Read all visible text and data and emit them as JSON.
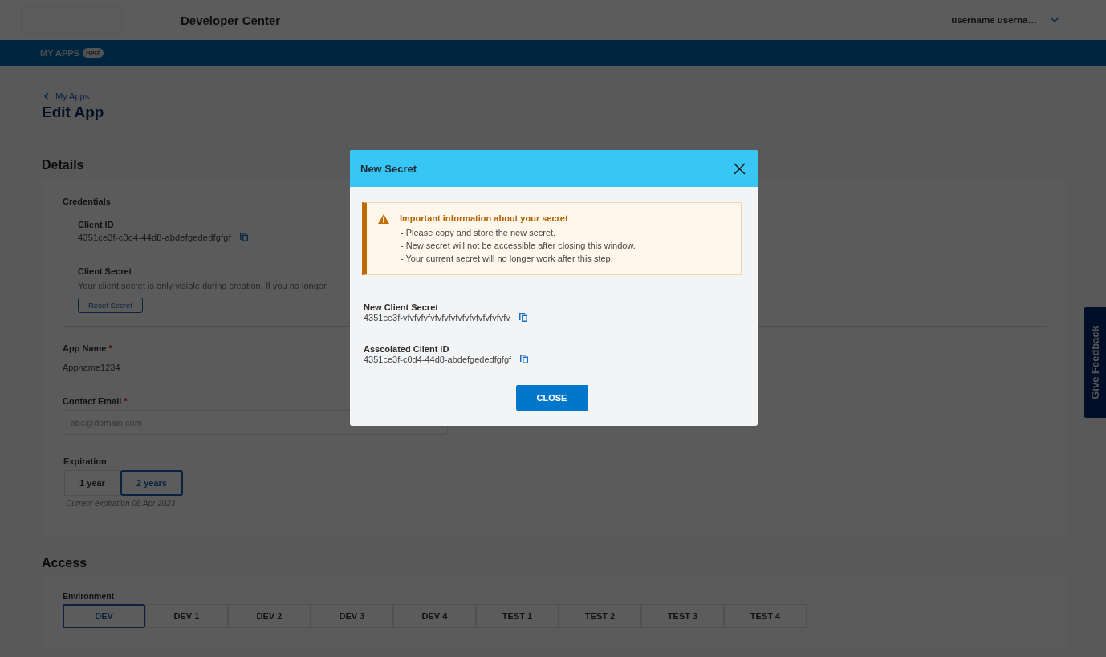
{
  "header": {
    "title": "Developer Center",
    "user": "username userna…"
  },
  "nav": {
    "items": [
      {
        "label": "MY APPS",
        "badge": "Beta"
      }
    ]
  },
  "breadcrumb": "My Apps",
  "page_title": "Edit App",
  "details": {
    "heading": "Details",
    "credentials": {
      "heading": "Credentials",
      "client_id_label": "Client ID",
      "client_id": "4351ce3f-c0d4-44d8-abdefgededfgfgf",
      "secret_label": "Client Secret",
      "secret_text": "Your client secret is only visible during creation. If you no longer",
      "reset_button": "Reset Secret"
    },
    "app_name": {
      "label": "App Name",
      "required_mark": "*",
      "value": "Appname1234"
    },
    "contact_email": {
      "label": "Contact Email",
      "required_mark": "*",
      "placeholder": "abc@domain.com"
    },
    "expiration": {
      "label": "Expiration",
      "options": [
        {
          "label": "1 year",
          "selected": false
        },
        {
          "label": "2 years",
          "selected": true
        }
      ],
      "note": "Current expiration 06 Apr 2023"
    }
  },
  "access": {
    "heading": "Access",
    "environment_label": "Environment",
    "tabs": [
      {
        "label": "DEV",
        "selected": true
      },
      {
        "label": "DEV 1",
        "selected": false
      },
      {
        "label": "DEV 2",
        "selected": false
      },
      {
        "label": "DEV 3",
        "selected": false
      },
      {
        "label": "DEV 4",
        "selected": false
      },
      {
        "label": "TEST 1",
        "selected": false
      },
      {
        "label": "TEST 2",
        "selected": false
      },
      {
        "label": "TEST 3",
        "selected": false
      },
      {
        "label": "TEST 4",
        "selected": false
      }
    ]
  },
  "feedback": "Give Feedback",
  "modal": {
    "title": "New Secret",
    "alert": {
      "title": "Important information about your secret",
      "lines": [
        "- Please copy and store the new secret.",
        "- New secret will not be accessible after closing this window.",
        "- Your current secret will no longer work after this step."
      ]
    },
    "fields": [
      {
        "label": "New Client Secret",
        "value": "4351ce3f-vfvfvfvfvfvfvfvfvfvfvfvfvfvfvfv"
      },
      {
        "label": "Asscoiated Client ID",
        "value": "4351ce3f-c0d4-44d8-abdefgededfgfgf"
      }
    ],
    "button": "CLOSE"
  }
}
